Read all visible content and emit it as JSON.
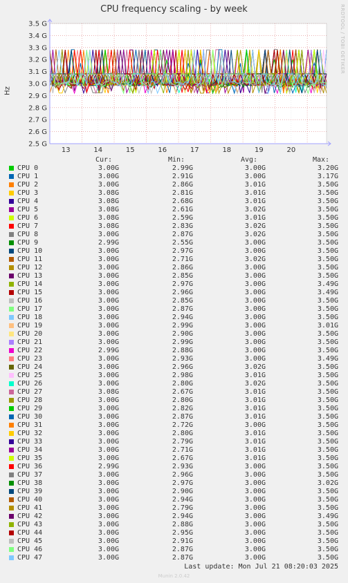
{
  "chart_data": {
    "type": "line",
    "title": "CPU frequency scaling - by week",
    "ylabel": "Hz",
    "y_ticks": [
      "2.5 G",
      "2.6 G",
      "2.7 G",
      "2.8 G",
      "2.9 G",
      "3.0 G",
      "3.1 G",
      "3.2 G",
      "3.3 G",
      "3.4 G",
      "3.5 G"
    ],
    "ylim": [
      2.5,
      3.5
    ],
    "x_ticks": [
      "13",
      "14",
      "15",
      "16",
      "17",
      "18",
      "19",
      "20"
    ],
    "grid": true,
    "legend_headers": {
      "cur": "Cur:",
      "min": "Min:",
      "avg": "Avg:",
      "max": "Max:"
    },
    "series": [
      {
        "name": "CPU 0",
        "color": "#00cc00",
        "cur": "3.00G",
        "min": "2.99G",
        "avg": "3.00G",
        "max": "3.20G"
      },
      {
        "name": "CPU 1",
        "color": "#0066b3",
        "cur": "3.00G",
        "min": "2.91G",
        "avg": "3.00G",
        "max": "3.17G"
      },
      {
        "name": "CPU 2",
        "color": "#ff8000",
        "cur": "3.00G",
        "min": "2.86G",
        "avg": "3.01G",
        "max": "3.50G"
      },
      {
        "name": "CPU 3",
        "color": "#ffcc00",
        "cur": "3.08G",
        "min": "2.81G",
        "avg": "3.01G",
        "max": "3.50G"
      },
      {
        "name": "CPU 4",
        "color": "#330099",
        "cur": "3.08G",
        "min": "2.68G",
        "avg": "3.01G",
        "max": "3.50G"
      },
      {
        "name": "CPU 5",
        "color": "#990099",
        "cur": "3.08G",
        "min": "2.61G",
        "avg": "3.02G",
        "max": "3.50G"
      },
      {
        "name": "CPU 6",
        "color": "#ccff00",
        "cur": "3.08G",
        "min": "2.59G",
        "avg": "3.01G",
        "max": "3.50G"
      },
      {
        "name": "CPU 7",
        "color": "#ff0000",
        "cur": "3.08G",
        "min": "2.83G",
        "avg": "3.02G",
        "max": "3.50G"
      },
      {
        "name": "CPU 8",
        "color": "#808080",
        "cur": "3.00G",
        "min": "2.87G",
        "avg": "3.02G",
        "max": "3.50G"
      },
      {
        "name": "CPU 9",
        "color": "#008f00",
        "cur": "2.99G",
        "min": "2.55G",
        "avg": "3.00G",
        "max": "3.50G"
      },
      {
        "name": "CPU 10",
        "color": "#00487d",
        "cur": "3.00G",
        "min": "2.97G",
        "avg": "3.00G",
        "max": "3.50G"
      },
      {
        "name": "CPU 11",
        "color": "#b35a00",
        "cur": "3.00G",
        "min": "2.71G",
        "avg": "3.02G",
        "max": "3.50G"
      },
      {
        "name": "CPU 12",
        "color": "#b38f00",
        "cur": "3.00G",
        "min": "2.86G",
        "avg": "3.00G",
        "max": "3.50G"
      },
      {
        "name": "CPU 13",
        "color": "#6b006b",
        "cur": "3.00G",
        "min": "2.85G",
        "avg": "3.00G",
        "max": "3.50G"
      },
      {
        "name": "CPU 14",
        "color": "#8fb300",
        "cur": "3.00G",
        "min": "2.97G",
        "avg": "3.00G",
        "max": "3.49G"
      },
      {
        "name": "CPU 15",
        "color": "#b30000",
        "cur": "3.00G",
        "min": "2.96G",
        "avg": "3.00G",
        "max": "3.49G"
      },
      {
        "name": "CPU 16",
        "color": "#bebebe",
        "cur": "3.00G",
        "min": "2.85G",
        "avg": "3.00G",
        "max": "3.50G"
      },
      {
        "name": "CPU 17",
        "color": "#80ff80",
        "cur": "3.00G",
        "min": "2.87G",
        "avg": "3.00G",
        "max": "3.50G"
      },
      {
        "name": "CPU 18",
        "color": "#80c9ff",
        "cur": "3.00G",
        "min": "2.94G",
        "avg": "3.00G",
        "max": "3.50G"
      },
      {
        "name": "CPU 19",
        "color": "#ffc080",
        "cur": "3.00G",
        "min": "2.99G",
        "avg": "3.00G",
        "max": "3.01G"
      },
      {
        "name": "CPU 20",
        "color": "#ffe680",
        "cur": "3.00G",
        "min": "2.90G",
        "avg": "3.00G",
        "max": "3.50G"
      },
      {
        "name": "CPU 21",
        "color": "#aa80ff",
        "cur": "3.00G",
        "min": "2.99G",
        "avg": "3.00G",
        "max": "3.50G"
      },
      {
        "name": "CPU 22",
        "color": "#ee00cc",
        "cur": "2.99G",
        "min": "2.88G",
        "avg": "3.00G",
        "max": "3.50G"
      },
      {
        "name": "CPU 23",
        "color": "#ff8080",
        "cur": "3.00G",
        "min": "2.93G",
        "avg": "3.00G",
        "max": "3.49G"
      },
      {
        "name": "CPU 24",
        "color": "#666600",
        "cur": "3.00G",
        "min": "2.96G",
        "avg": "3.02G",
        "max": "3.50G"
      },
      {
        "name": "CPU 25",
        "color": "#ffbfff",
        "cur": "3.00G",
        "min": "2.98G",
        "avg": "3.01G",
        "max": "3.50G"
      },
      {
        "name": "CPU 26",
        "color": "#00ffcc",
        "cur": "3.00G",
        "min": "2.80G",
        "avg": "3.02G",
        "max": "3.50G"
      },
      {
        "name": "CPU 27",
        "color": "#cc6699",
        "cur": "3.08G",
        "min": "2.67G",
        "avg": "3.01G",
        "max": "3.50G"
      },
      {
        "name": "CPU 28",
        "color": "#999900",
        "cur": "3.00G",
        "min": "2.80G",
        "avg": "3.01G",
        "max": "3.50G"
      },
      {
        "name": "CPU 29",
        "color": "#00cc00",
        "cur": "3.00G",
        "min": "2.82G",
        "avg": "3.01G",
        "max": "3.50G"
      },
      {
        "name": "CPU 30",
        "color": "#0066b3",
        "cur": "3.00G",
        "min": "2.87G",
        "avg": "3.01G",
        "max": "3.50G"
      },
      {
        "name": "CPU 31",
        "color": "#ff8000",
        "cur": "3.00G",
        "min": "2.72G",
        "avg": "3.00G",
        "max": "3.50G"
      },
      {
        "name": "CPU 32",
        "color": "#ffcc00",
        "cur": "3.00G",
        "min": "2.80G",
        "avg": "3.01G",
        "max": "3.50G"
      },
      {
        "name": "CPU 33",
        "color": "#330099",
        "cur": "3.00G",
        "min": "2.79G",
        "avg": "3.01G",
        "max": "3.50G"
      },
      {
        "name": "CPU 34",
        "color": "#990099",
        "cur": "3.00G",
        "min": "2.71G",
        "avg": "3.01G",
        "max": "3.50G"
      },
      {
        "name": "CPU 35",
        "color": "#ccff00",
        "cur": "3.00G",
        "min": "2.67G",
        "avg": "3.01G",
        "max": "3.50G"
      },
      {
        "name": "CPU 36",
        "color": "#ff0000",
        "cur": "2.99G",
        "min": "2.93G",
        "avg": "3.00G",
        "max": "3.50G"
      },
      {
        "name": "CPU 37",
        "color": "#808080",
        "cur": "3.00G",
        "min": "2.96G",
        "avg": "3.00G",
        "max": "3.50G"
      },
      {
        "name": "CPU 38",
        "color": "#008f00",
        "cur": "3.00G",
        "min": "2.97G",
        "avg": "3.00G",
        "max": "3.02G"
      },
      {
        "name": "CPU 39",
        "color": "#00487d",
        "cur": "3.00G",
        "min": "2.90G",
        "avg": "3.00G",
        "max": "3.50G"
      },
      {
        "name": "CPU 40",
        "color": "#b35a00",
        "cur": "3.00G",
        "min": "2.94G",
        "avg": "3.00G",
        "max": "3.50G"
      },
      {
        "name": "CPU 41",
        "color": "#b38f00",
        "cur": "3.00G",
        "min": "2.79G",
        "avg": "3.00G",
        "max": "3.50G"
      },
      {
        "name": "CPU 42",
        "color": "#6b006b",
        "cur": "3.00G",
        "min": "2.94G",
        "avg": "3.00G",
        "max": "3.49G"
      },
      {
        "name": "CPU 43",
        "color": "#8fb300",
        "cur": "3.00G",
        "min": "2.88G",
        "avg": "3.00G",
        "max": "3.50G"
      },
      {
        "name": "CPU 44",
        "color": "#b30000",
        "cur": "3.00G",
        "min": "2.95G",
        "avg": "3.00G",
        "max": "3.50G"
      },
      {
        "name": "CPU 45",
        "color": "#bebebe",
        "cur": "3.00G",
        "min": "2.91G",
        "avg": "3.00G",
        "max": "3.50G"
      },
      {
        "name": "CPU 46",
        "color": "#80ff80",
        "cur": "3.00G",
        "min": "2.87G",
        "avg": "3.00G",
        "max": "3.50G"
      },
      {
        "name": "CPU 47",
        "color": "#80c9ff",
        "cur": "3.00G",
        "min": "2.87G",
        "avg": "3.00G",
        "max": "3.50G"
      }
    ]
  },
  "last_update": "Last update: Mon Jul 21 08:20:03 2025",
  "rrdtool_label": "RRDTOOL / TOBI OETIKER",
  "munin_version": "Munin 2.0.42"
}
